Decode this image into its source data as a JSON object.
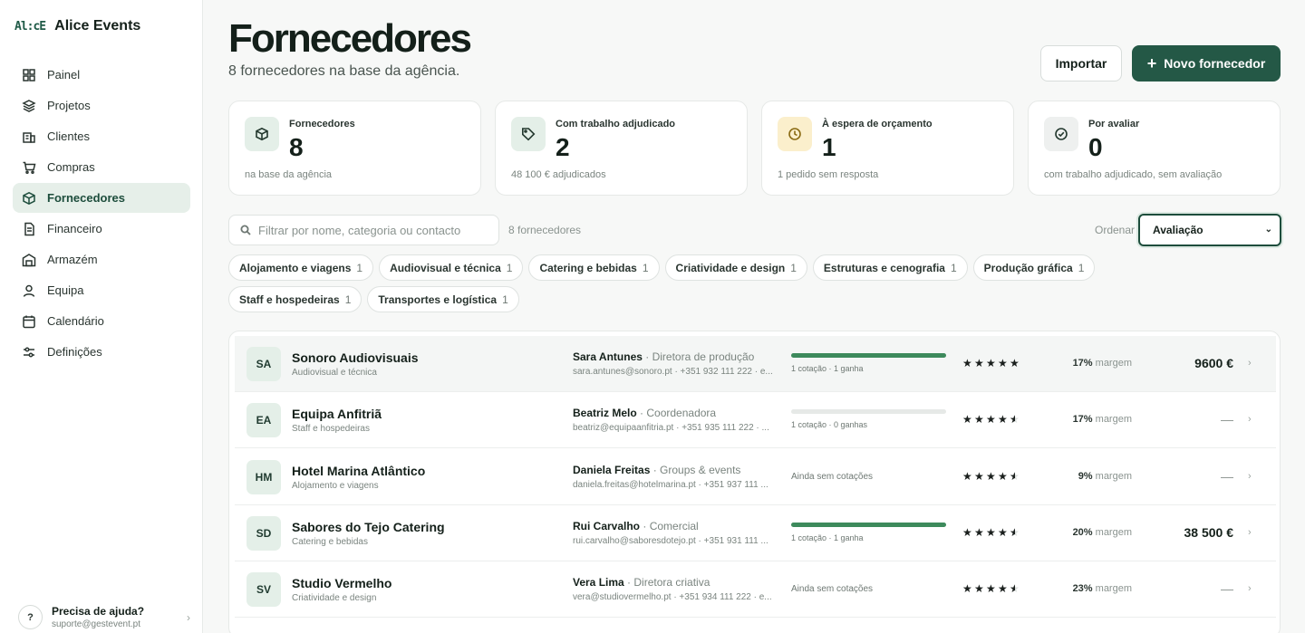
{
  "brand": {
    "logo": "Al:cE",
    "name": "Alice Events"
  },
  "nav": [
    {
      "label": "Painel",
      "icon": "grid-icon",
      "active": false
    },
    {
      "label": "Projetos",
      "icon": "layers-icon",
      "active": false
    },
    {
      "label": "Clientes",
      "icon": "building-icon",
      "active": false
    },
    {
      "label": "Compras",
      "icon": "cart-icon",
      "active": false
    },
    {
      "label": "Fornecedores",
      "icon": "package-icon",
      "active": true
    },
    {
      "label": "Financeiro",
      "icon": "document-icon",
      "active": false
    },
    {
      "label": "Armazém",
      "icon": "warehouse-icon",
      "active": false
    },
    {
      "label": "Equipa",
      "icon": "user-icon",
      "active": false
    },
    {
      "label": "Calendário",
      "icon": "calendar-icon",
      "active": false
    },
    {
      "label": "Definições",
      "icon": "sliders-icon",
      "active": false
    }
  ],
  "help": {
    "badge": "?",
    "title": "Precisa de ajuda?",
    "email": "suporte@gestevent.pt",
    "chevron": "›"
  },
  "header": {
    "title": "Fornecedores",
    "subtitle": "8 fornecedores na base da agência.",
    "import_label": "Importar",
    "new_icon": "+",
    "new_label": "Novo fornecedor"
  },
  "stats": [
    {
      "label": "Fornecedores",
      "value": "8",
      "foot": "na base da agência",
      "icon": "package-icon",
      "tone": "green"
    },
    {
      "label": "Com trabalho adjudicado",
      "value": "2",
      "foot": "48 100 € adjudicados",
      "icon": "tag-icon",
      "tone": "green"
    },
    {
      "label": "À espera de orçamento",
      "value": "1",
      "foot": "1 pedido sem resposta",
      "icon": "clock-icon",
      "tone": "amber"
    },
    {
      "label": "Por avaliar",
      "value": "0",
      "foot": "com trabalho adjudicado, sem avaliação",
      "icon": "check-circle-icon",
      "tone": "gray"
    }
  ],
  "toolbar": {
    "search_placeholder": "Filtrar por nome, categoria ou contacto",
    "count": "8 fornecedores",
    "order_label": "Ordenar",
    "order_value": "Avaliação",
    "order_chevron": "⌄"
  },
  "chips": [
    {
      "label": "Alojamento e viagens",
      "count": "1"
    },
    {
      "label": "Audiovisual e técnica",
      "count": "1"
    },
    {
      "label": "Catering e bebidas",
      "count": "1"
    },
    {
      "label": "Criatividade e design",
      "count": "1"
    },
    {
      "label": "Estruturas e cenografia",
      "count": "1"
    },
    {
      "label": "Produção gráfica",
      "count": "1"
    },
    {
      "label": "Staff e hospedeiras",
      "count": "1"
    },
    {
      "label": "Transportes e logística",
      "count": "1"
    }
  ],
  "suppliers": [
    {
      "initials": "SA",
      "name": "Sonoro Audiovisuais",
      "category": "Audiovisual e técnica",
      "contact_name": "Sara Antunes",
      "contact_role": "· Diretora de produção",
      "contact_details": "sara.antunes@sonoro.pt · +351 932 111 222 · e...",
      "progress": 1.0,
      "quotes": "1 cotação · 1 ganha",
      "rating": 5.0,
      "margin_value": "17%",
      "margin_label": "margem",
      "total": "9600 €",
      "chevron": "›"
    },
    {
      "initials": "EA",
      "name": "Equipa Anfitriã",
      "category": "Staff e hospedeiras",
      "contact_name": "Beatriz Melo",
      "contact_role": "· Coordenadora",
      "contact_details": "beatriz@equipaanfitria.pt · +351 935 111 222 · ...",
      "progress": 0.0,
      "quotes": "1 cotação · 0 ganhas",
      "rating": 4.5,
      "margin_value": "17%",
      "margin_label": "margem",
      "total": "—",
      "chevron": "›"
    },
    {
      "initials": "HM",
      "name": "Hotel Marina Atlântico",
      "category": "Alojamento e viagens",
      "contact_name": "Daniela Freitas",
      "contact_role": "· Groups & events",
      "contact_details": "daniela.freitas@hotelmarina.pt · +351 937 111 ...",
      "progress": null,
      "quotes": "Ainda sem cotações",
      "rating": 4.5,
      "margin_value": "9%",
      "margin_label": "margem",
      "total": "—",
      "chevron": "›"
    },
    {
      "initials": "SD",
      "name": "Sabores do Tejo Catering",
      "category": "Catering e bebidas",
      "contact_name": "Rui Carvalho",
      "contact_role": "· Comercial",
      "contact_details": "rui.carvalho@saboresdotejo.pt · +351 931 111 ...",
      "progress": 1.0,
      "quotes": "1 cotação · 1 ganha",
      "rating": 4.5,
      "margin_value": "20%",
      "margin_label": "margem",
      "total": "38 500 €",
      "chevron": "›"
    },
    {
      "initials": "SV",
      "name": "Studio Vermelho",
      "category": "Criatividade e design",
      "contact_name": "Vera Lima",
      "contact_role": "· Diretora criativa",
      "contact_details": "vera@studiovermelho.pt · +351 934 111 222 · e...",
      "progress": null,
      "quotes": "Ainda sem cotações",
      "rating": 4.5,
      "margin_value": "23%",
      "margin_label": "margem",
      "total": "—",
      "chevron": "›"
    }
  ],
  "colors": {
    "accent": "#245846",
    "accent_soft": "#e6efe9",
    "progress": "#3d8a5c",
    "amber": "#fbefcc"
  }
}
